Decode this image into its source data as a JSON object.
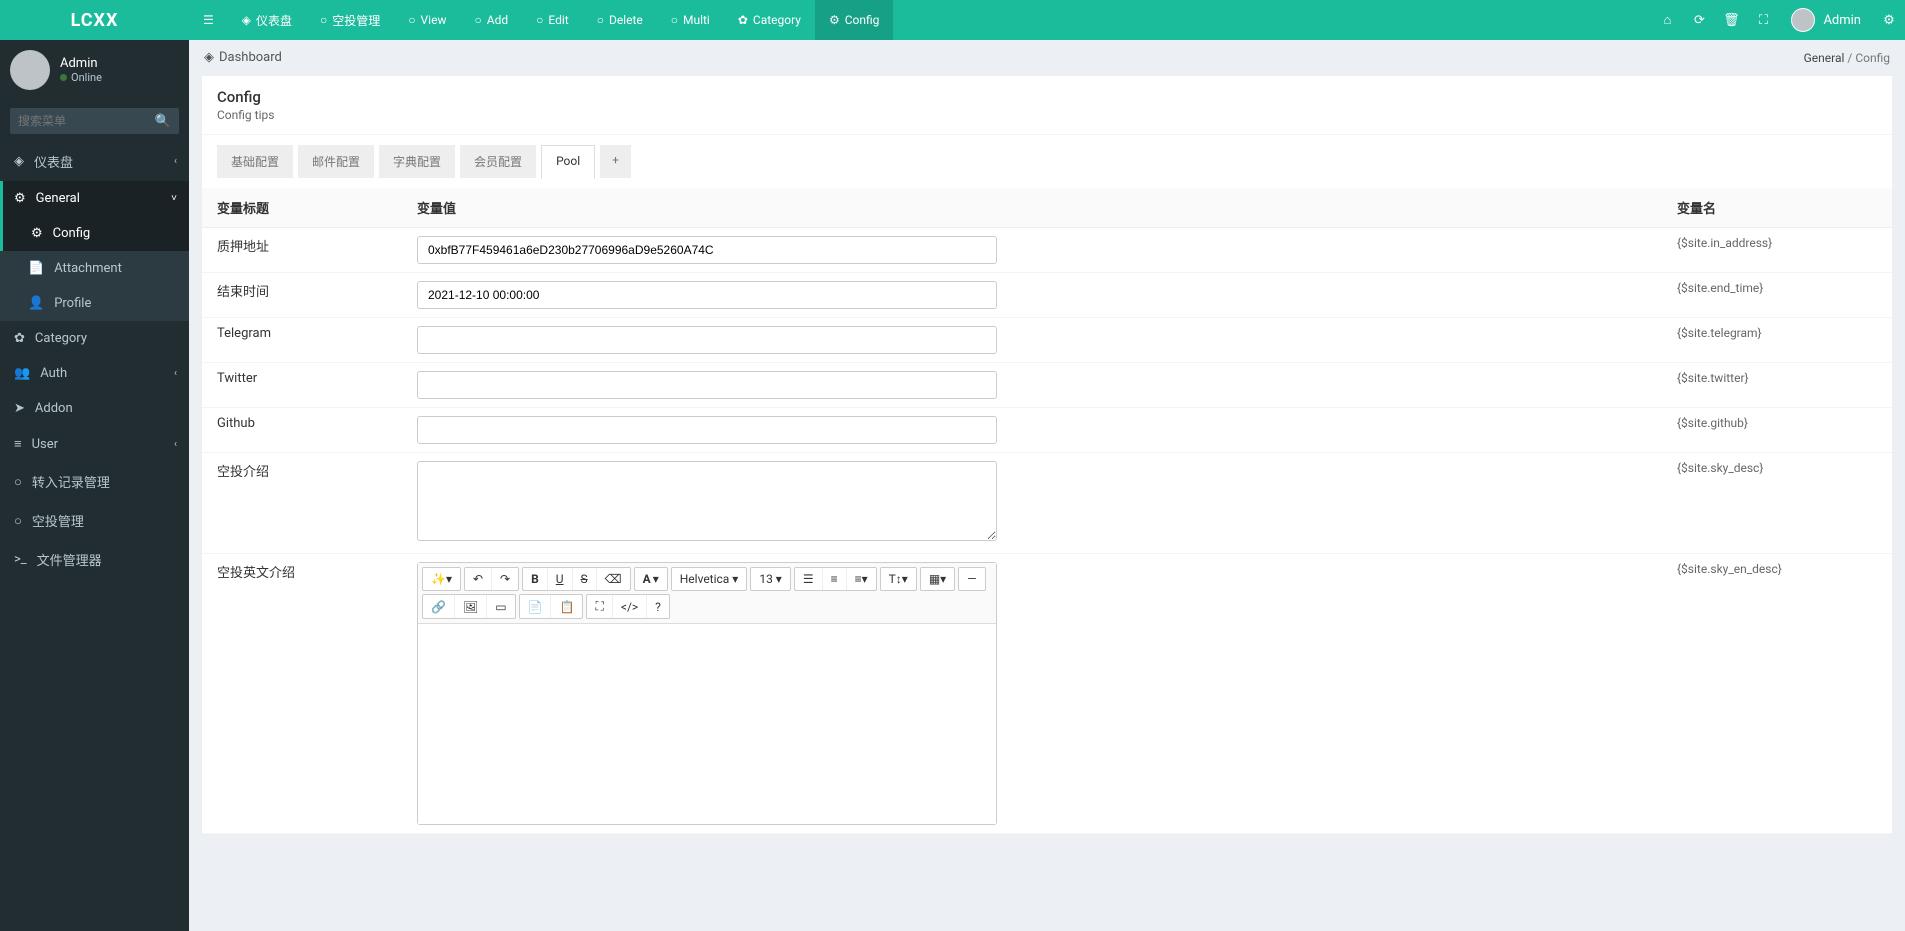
{
  "brand": "LCXX",
  "topnav": [
    {
      "icon": "bars",
      "label": ""
    },
    {
      "icon": "dashboard",
      "label": "仪表盘"
    },
    {
      "icon": "circle",
      "label": "空投管理"
    },
    {
      "icon": "circle",
      "label": "View"
    },
    {
      "icon": "circle",
      "label": "Add"
    },
    {
      "icon": "circle",
      "label": "Edit"
    },
    {
      "icon": "circle",
      "label": "Delete"
    },
    {
      "icon": "circle",
      "label": "Multi"
    },
    {
      "icon": "leaf",
      "label": "Category"
    },
    {
      "icon": "cog",
      "label": "Config",
      "active": true
    }
  ],
  "topright_user": "Admin",
  "sidebar_user": {
    "name": "Admin",
    "status": "Online"
  },
  "search_placeholder": "搜索菜单",
  "menu": [
    {
      "icon": "dashboard",
      "label": "仪表盘",
      "chev": "‹"
    },
    {
      "icon": "cogs",
      "label": "General",
      "chev": "˅",
      "active": true
    },
    {
      "icon": "cog",
      "label": "Config",
      "sub": true,
      "active": true
    },
    {
      "icon": "file",
      "label": "Attachment",
      "sub": true
    },
    {
      "icon": "user",
      "label": "Profile",
      "sub": true
    },
    {
      "icon": "leaf",
      "label": "Category"
    },
    {
      "icon": "group",
      "label": "Auth",
      "chev": "‹"
    },
    {
      "icon": "rocket",
      "label": "Addon"
    },
    {
      "icon": "list",
      "label": "User",
      "chev": "‹"
    },
    {
      "icon": "circle",
      "label": "转入记录管理"
    },
    {
      "icon": "circle",
      "label": "空投管理"
    },
    {
      "icon": "terminal",
      "label": "文件管理器"
    }
  ],
  "breadcrumb": {
    "left": "Dashboard",
    "right_parent": "General",
    "right_current": "Config"
  },
  "panel": {
    "title": "Config",
    "subtitle": "Config tips"
  },
  "tabs": [
    "基础配置",
    "邮件配置",
    "字典配置",
    "会员配置",
    "Pool"
  ],
  "active_tab": "Pool",
  "headers": {
    "title": "变量标题",
    "value": "变量值",
    "name": "变量名"
  },
  "rows": [
    {
      "title": "质押地址",
      "value": "0xbfB77F459461a6eD230b27706996aD9e5260A74C",
      "var": "{$site.in_address}"
    },
    {
      "title": "结束时间",
      "value": "2021-12-10 00:00:00",
      "var": "{$site.end_time}"
    },
    {
      "title": "Telegram",
      "value": "",
      "var": "{$site.telegram}"
    },
    {
      "title": "Twitter",
      "value": "",
      "var": "{$site.twitter}"
    },
    {
      "title": "Github",
      "value": "",
      "var": "{$site.github}"
    },
    {
      "title": "空投介绍",
      "value": "",
      "var": "{$site.sky_desc}",
      "type": "textarea"
    },
    {
      "title": "空投英文介绍",
      "value": "",
      "var": "{$site.sky_en_desc}",
      "type": "editor"
    }
  ],
  "editor": {
    "font": "Helvetica",
    "size": "13"
  }
}
